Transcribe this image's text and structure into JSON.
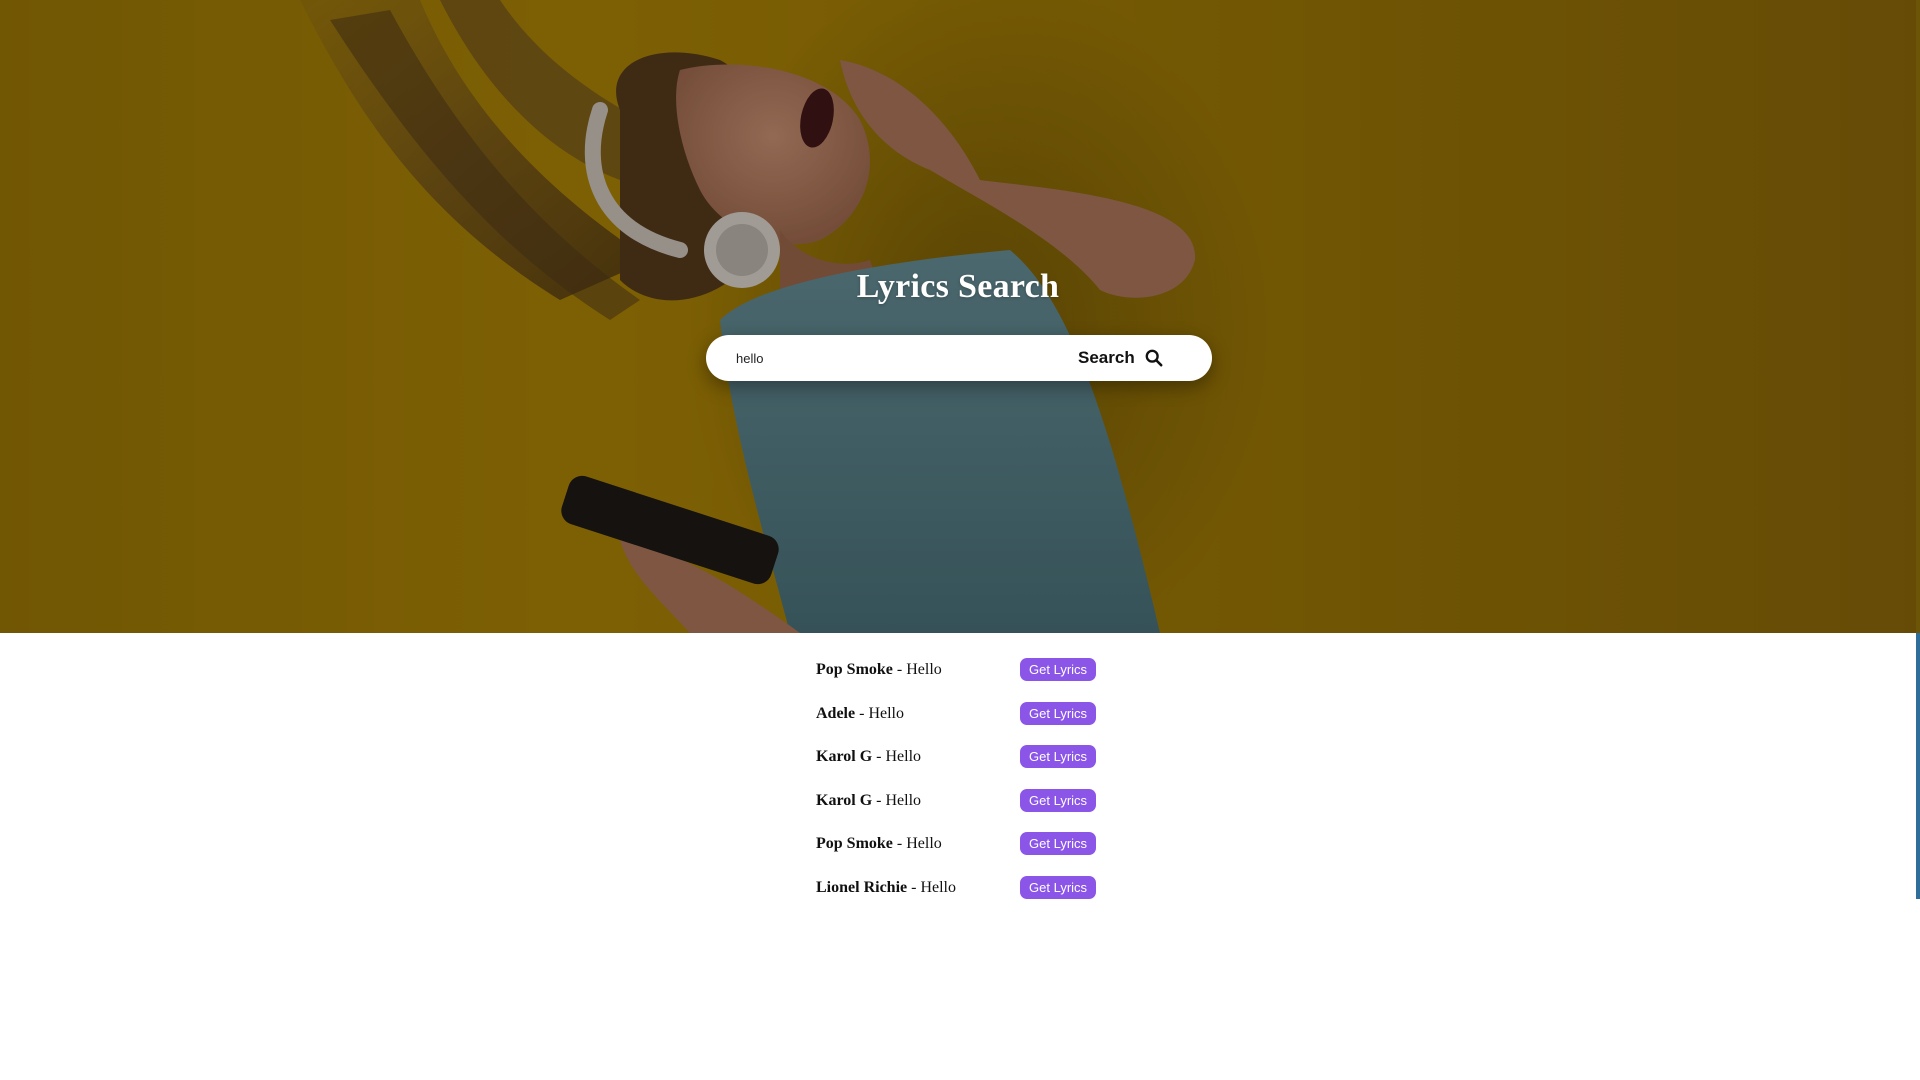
{
  "hero": {
    "title": "Lyrics Search",
    "background_color": "#8a6a06"
  },
  "search": {
    "value": "hello",
    "placeholder": "Search",
    "button_label": "Search",
    "button_icon": "search-icon"
  },
  "results": [
    {
      "artist": "Pop Smoke",
      "separator": " - ",
      "song": "Hello",
      "button_label": "Get Lyrics"
    },
    {
      "artist": "Adele",
      "separator": " - ",
      "song": "Hello",
      "button_label": "Get Lyrics"
    },
    {
      "artist": "Karol G",
      "separator": " - ",
      "song": "Hello",
      "button_label": "Get Lyrics"
    },
    {
      "artist": "Karol G",
      "separator": " - ",
      "song": "Hello",
      "button_label": "Get Lyrics"
    },
    {
      "artist": "Pop Smoke",
      "separator": " - ",
      "song": "Hello",
      "button_label": "Get Lyrics"
    },
    {
      "artist": "Lionel Richie",
      "separator": " - ",
      "song": "Hello",
      "button_label": "Get Lyrics"
    }
  ],
  "colors": {
    "accent": "#8b55e8",
    "hero_overlay": "#7a5c06"
  }
}
